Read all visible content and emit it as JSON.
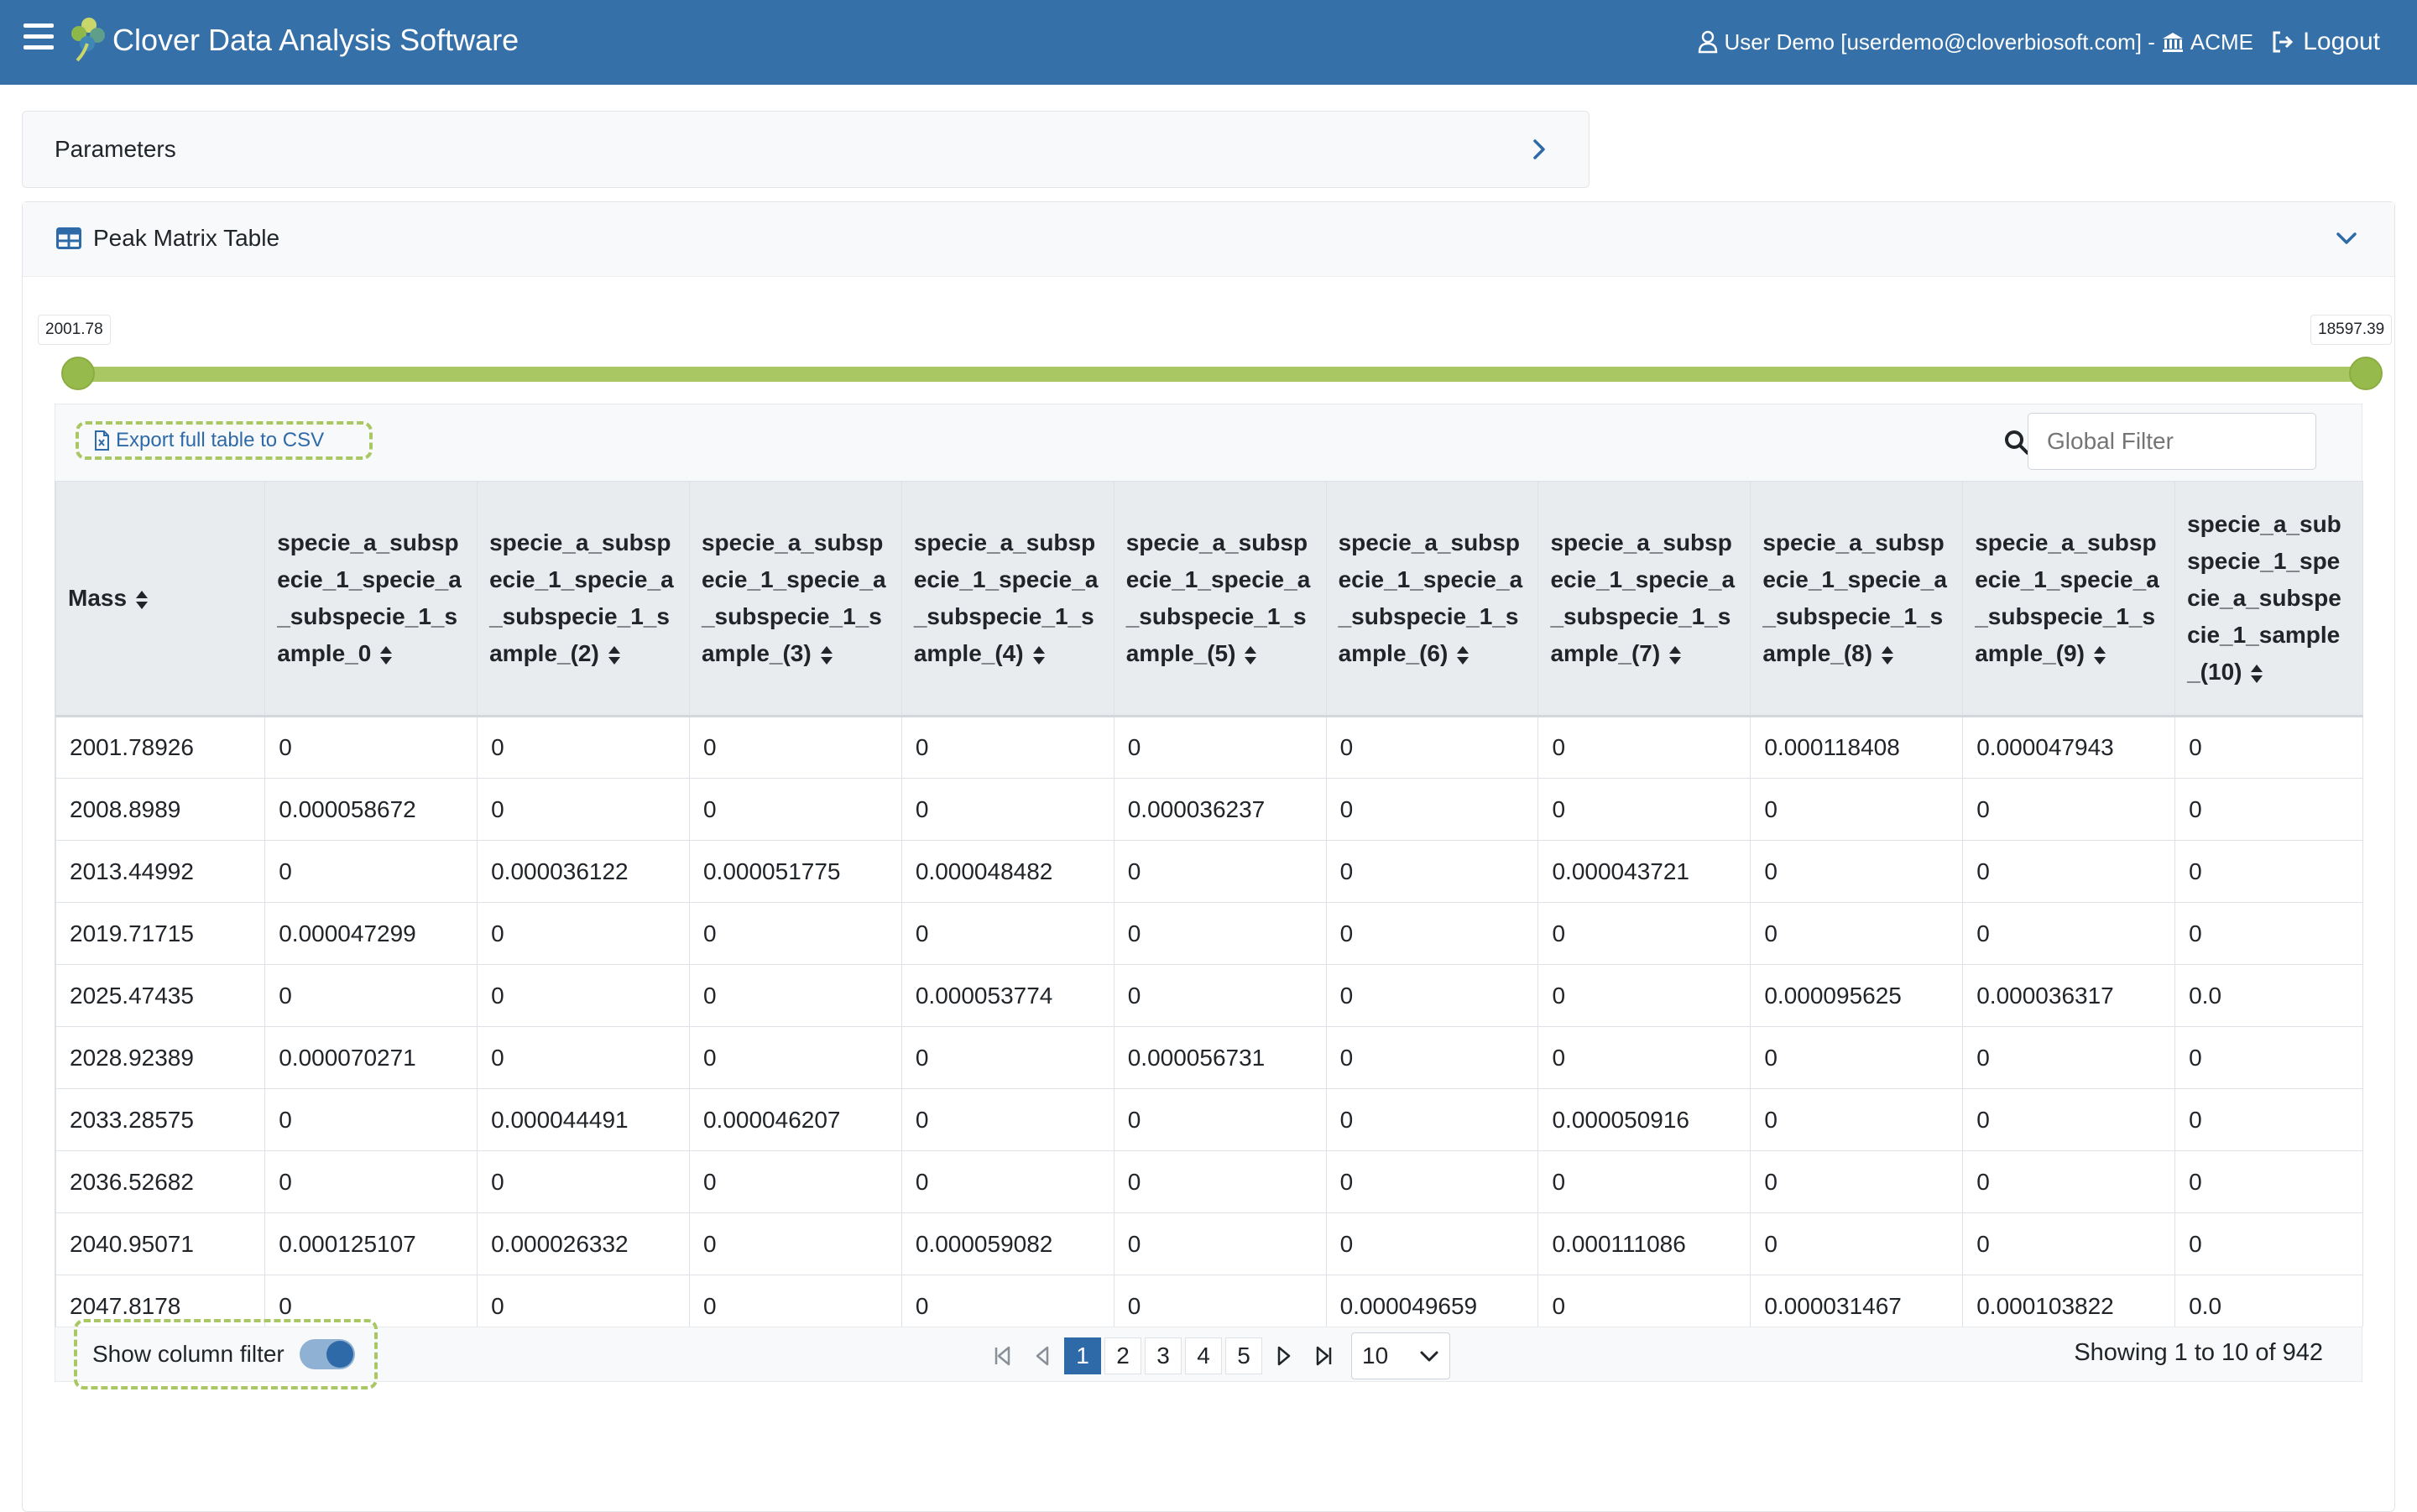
{
  "navbar": {
    "brand": "Clover Data Analysis Software",
    "user_text": "User Demo [userdemo@cloverbiosoft.com] -",
    "org": "ACME",
    "logout": "Logout",
    "icons": [
      "hamburger-icon",
      "clover-logo",
      "user-icon",
      "building-icon",
      "logout-icon"
    ]
  },
  "parameters": {
    "title": "Parameters"
  },
  "peak_matrix": {
    "title": "Peak Matrix Table",
    "slider": {
      "min_label": "2001.78",
      "max_label": "18597.39",
      "low": 2001.78,
      "high": 18597.39
    },
    "export_label": "Export full table to CSV",
    "global_filter_placeholder": "Global Filter",
    "columns": [
      "Mass",
      "specie_a_subspecie_1_specie_a_subspecie_1_sample_0",
      "specie_a_subspecie_1_specie_a_subspecie_1_sample_(2)",
      "specie_a_subspecie_1_specie_a_subspecie_1_sample_(3)",
      "specie_a_subspecie_1_specie_a_subspecie_1_sample_(4)",
      "specie_a_subspecie_1_specie_a_subspecie_1_sample_(5)",
      "specie_a_subspecie_1_specie_a_subspecie_1_sample_(6)",
      "specie_a_subspecie_1_specie_a_subspecie_1_sample_(7)",
      "specie_a_subspecie_1_specie_a_subspecie_1_sample_(8)",
      "specie_a_subspecie_1_specie_a_subspecie_1_sample_(9)",
      "specie_a_subspecie_1_specie_a_subspecie_1_sample_(10)"
    ],
    "rows": [
      [
        "2001.78926",
        "0",
        "0",
        "0",
        "0",
        "0",
        "0",
        "0",
        "0.000118408",
        "0.000047943",
        "0"
      ],
      [
        "2008.8989",
        "0.000058672",
        "0",
        "0",
        "0",
        "0.000036237",
        "0",
        "0",
        "0",
        "0",
        "0"
      ],
      [
        "2013.44992",
        "0",
        "0.000036122",
        "0.000051775",
        "0.000048482",
        "0",
        "0",
        "0.000043721",
        "0",
        "0",
        "0"
      ],
      [
        "2019.71715",
        "0.000047299",
        "0",
        "0",
        "0",
        "0",
        "0",
        "0",
        "0",
        "0",
        "0"
      ],
      [
        "2025.47435",
        "0",
        "0",
        "0",
        "0.000053774",
        "0",
        "0",
        "0",
        "0.000095625",
        "0.000036317",
        "0.0"
      ],
      [
        "2028.92389",
        "0.000070271",
        "0",
        "0",
        "0",
        "0.000056731",
        "0",
        "0",
        "0",
        "0",
        "0"
      ],
      [
        "2033.28575",
        "0",
        "0.000044491",
        "0.000046207",
        "0",
        "0",
        "0",
        "0.000050916",
        "0",
        "0",
        "0"
      ],
      [
        "2036.52682",
        "0",
        "0",
        "0",
        "0",
        "0",
        "0",
        "0",
        "0",
        "0",
        "0"
      ],
      [
        "2040.95071",
        "0.000125107",
        "0.000026332",
        "0",
        "0.000059082",
        "0",
        "0",
        "0.000111086",
        "0",
        "0",
        "0"
      ],
      [
        "2047.8178",
        "0",
        "0",
        "0",
        "0",
        "0",
        "0.000049659",
        "0",
        "0.000031467",
        "0.000103822",
        "0.0"
      ]
    ],
    "footer": {
      "column_filter_label": "Show column filter",
      "column_filter_on": true,
      "pages": [
        "1",
        "2",
        "3",
        "4",
        "5"
      ],
      "current_page": "1",
      "page_size": "10",
      "showing": "Showing 1 to 10 of 942"
    }
  },
  "colors": {
    "navbar": "#3670a8",
    "accent": "#2f6aa8",
    "slider": "#a9c763"
  }
}
